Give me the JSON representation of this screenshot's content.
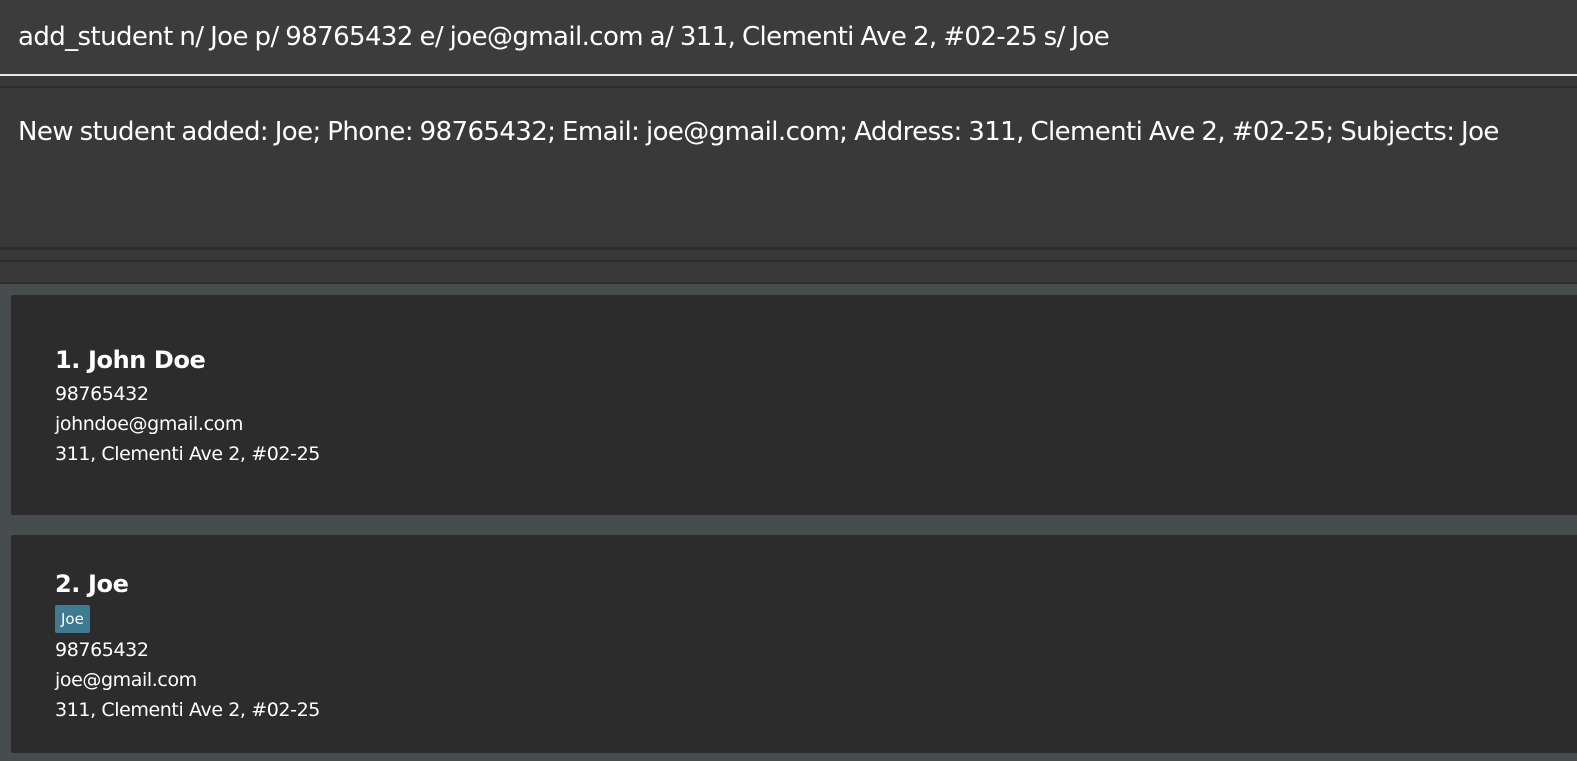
{
  "command": {
    "value": "add_student n/ Joe p/ 98765432 e/ joe@gmail.com a/ 311, Clementi Ave 2, #02-25 s/ Joe"
  },
  "result": {
    "message": "New student added: Joe; Phone: 98765432; Email: joe@gmail.com; Address: 311, Clementi Ave 2, #02-25; Subjects: Joe"
  },
  "students": [
    {
      "name": "1. John Doe",
      "tags": [],
      "phone": "98765432",
      "email": "johndoe@gmail.com",
      "address": "311, Clementi Ave 2, #02-25"
    },
    {
      "name": "2. Joe",
      "tags": [
        "Joe"
      ],
      "phone": "98765432",
      "email": "joe@gmail.com",
      "address": "311, Clementi Ave 2, #02-25"
    }
  ],
  "colors": {
    "background": "#383838",
    "card": "#2c2c2c",
    "list_background": "#474c4e",
    "tag": "#3e7b91",
    "text": "#ffffff"
  }
}
